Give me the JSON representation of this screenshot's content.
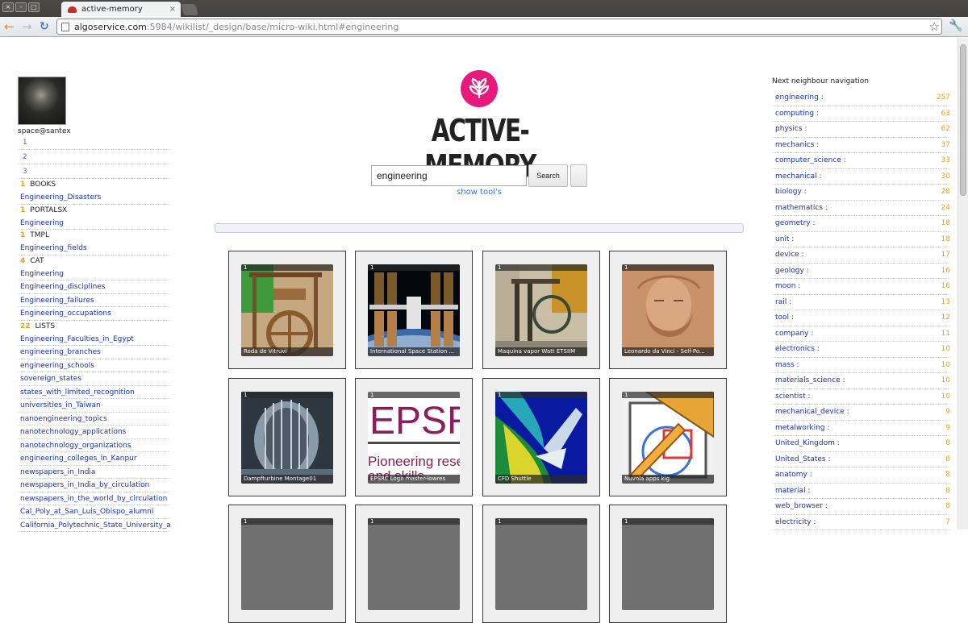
{
  "browser": {
    "tab_title": "active-memory",
    "url_host": "algoservice.com",
    "url_path": ":5984/wikilist/_design/base/micro-wiki.html#engineering"
  },
  "user": {
    "name": "space@santex"
  },
  "left": {
    "numbers": [
      "1",
      "2",
      "3"
    ],
    "groups": [
      {
        "count": "1",
        "name": "BOOKS",
        "links": [
          "Engineering_Disasters"
        ]
      },
      {
        "count": "1",
        "name": "PORTALSX",
        "links": [
          "Engineering"
        ]
      },
      {
        "count": "1",
        "name": "TMPL",
        "links": [
          "Engineering_fields"
        ]
      },
      {
        "count": "4",
        "name": "CAT",
        "links": [
          "Engineering",
          "Engineering_disciplines",
          "Engineering_failures",
          "Engineering_occupations"
        ]
      },
      {
        "count": "22",
        "name": "LISTS",
        "links": [
          "Engineering_Faculties_in_Egypt",
          "engineering_branches",
          "engineering_schools",
          "sovereign_states",
          "states_with_limited_recognition",
          "universities_in_Taiwan",
          "nanoengineering_topics",
          "nanotechnology_applications",
          "nanotechnology_organizations",
          "engineering_colleges_in_Kanpur",
          "newspapers_in_India",
          "newspapers_in_India_by_circulation",
          "newspapers_in_the_world_by_circulation",
          "Cal_Poly_at_San_Luis_Obispo_alumni",
          "California_Polytechnic_State_University_alu"
        ]
      }
    ]
  },
  "center": {
    "logo_title": "ACTIVE-MEMORY",
    "search_value": "engineering",
    "search_button": "Search",
    "show_tools": "show tool's",
    "thumbnails": [
      {
        "num": "1",
        "caption": "Roda de Vitruvi",
        "art": "waterwheel"
      },
      {
        "num": "1",
        "caption": "International Space Station ...",
        "art": "station"
      },
      {
        "num": "1",
        "caption": "Maquina vapor Watt ETSIIM",
        "art": "steam"
      },
      {
        "num": "1",
        "caption": "Leonardo da Vinci - Self-Po...",
        "art": "davinci"
      },
      {
        "num": "1",
        "caption": "Dampfturbine Montage01",
        "art": "turbine"
      },
      {
        "num": "1",
        "caption": "EPSRC Logo master-lowres",
        "art": "epsrc"
      },
      {
        "num": "1",
        "caption": "CFD Shuttle",
        "art": "shuttle"
      },
      {
        "num": "1",
        "caption": "Nuvola apps kig",
        "art": "kig"
      },
      {
        "num": "1",
        "caption": "",
        "art": "blank"
      },
      {
        "num": "1",
        "caption": "",
        "art": "blank"
      },
      {
        "num": "1",
        "caption": "",
        "art": "blank"
      },
      {
        "num": "1",
        "caption": "",
        "art": "blank"
      }
    ]
  },
  "right": {
    "heading": "Next neighbour navigation",
    "items": [
      {
        "label": "engineering :",
        "count": "257"
      },
      {
        "label": "computing :",
        "count": "63"
      },
      {
        "label": "physics :",
        "count": "62"
      },
      {
        "label": "mechanics :",
        "count": "37"
      },
      {
        "label": "computer_science :",
        "count": "33"
      },
      {
        "label": "mechanical :",
        "count": "30"
      },
      {
        "label": "biology :",
        "count": "28"
      },
      {
        "label": "mathematics :",
        "count": "24"
      },
      {
        "label": "geometry :",
        "count": "18"
      },
      {
        "label": "unit :",
        "count": "18"
      },
      {
        "label": "device :",
        "count": "17"
      },
      {
        "label": "geology :",
        "count": "16"
      },
      {
        "label": "moon :",
        "count": "16"
      },
      {
        "label": "rail :",
        "count": "13"
      },
      {
        "label": "tool :",
        "count": "12"
      },
      {
        "label": "company :",
        "count": "11"
      },
      {
        "label": "electronics :",
        "count": "10"
      },
      {
        "label": "mass :",
        "count": "10"
      },
      {
        "label": "materials_science :",
        "count": "10"
      },
      {
        "label": "scientist :",
        "count": "10"
      },
      {
        "label": "mechanical_device :",
        "count": "9"
      },
      {
        "label": "metalworking :",
        "count": "9"
      },
      {
        "label": "United_Kingdom :",
        "count": "8"
      },
      {
        "label": "United_States :",
        "count": "8"
      },
      {
        "label": "anatomy :",
        "count": "8"
      },
      {
        "label": "material :",
        "count": "8"
      },
      {
        "label": "web_browser :",
        "count": "8"
      },
      {
        "label": "electricity :",
        "count": "7"
      }
    ]
  }
}
